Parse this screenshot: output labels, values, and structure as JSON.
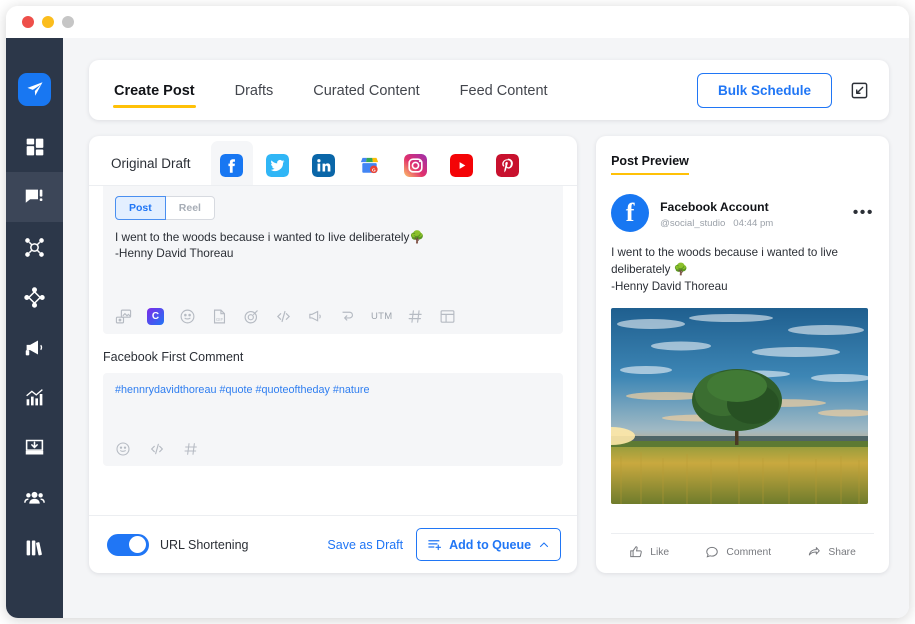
{
  "window": {
    "controls": [
      "close",
      "minimize",
      "maximize"
    ]
  },
  "sidebar": {
    "items": [
      {
        "name": "logo",
        "icon": "paper-plane-icon"
      },
      {
        "name": "dashboard",
        "icon": "grid-icon"
      },
      {
        "name": "publish",
        "icon": "message-icon",
        "active": true
      },
      {
        "name": "network",
        "icon": "network-icon"
      },
      {
        "name": "engage",
        "icon": "diamond-nodes-icon"
      },
      {
        "name": "campaigns",
        "icon": "megaphone-icon"
      },
      {
        "name": "analytics",
        "icon": "chart-icon"
      },
      {
        "name": "inbox",
        "icon": "inbox-download-icon"
      },
      {
        "name": "team",
        "icon": "users-icon"
      },
      {
        "name": "library",
        "icon": "books-icon"
      }
    ]
  },
  "topbar": {
    "tabs": [
      {
        "label": "Create Post",
        "active": true
      },
      {
        "label": "Drafts",
        "active": false
      },
      {
        "label": "Curated Content",
        "active": false
      },
      {
        "label": "Feed Content",
        "active": false
      }
    ],
    "bulk_schedule_label": "Bulk Schedule",
    "compose_icon": "compose-icon"
  },
  "composer": {
    "original_draft_label": "Original Draft",
    "networks": [
      {
        "name": "facebook",
        "active": true
      },
      {
        "name": "twitter",
        "active": false
      },
      {
        "name": "linkedin",
        "active": false
      },
      {
        "name": "google-business",
        "active": false
      },
      {
        "name": "instagram",
        "active": false
      },
      {
        "name": "youtube",
        "active": false
      },
      {
        "name": "pinterest",
        "active": false
      }
    ],
    "post_reel": {
      "post_label": "Post",
      "reel_label": "Reel",
      "selected": "Post"
    },
    "post_text_line1": "I went to the woods because i wanted to live deliberately",
    "post_emoji": "🌳",
    "post_text_line2": "-Henny David Thoreau",
    "toolbar": [
      {
        "name": "media-icon"
      },
      {
        "name": "canva-icon",
        "label": "C"
      },
      {
        "name": "emoji-icon"
      },
      {
        "name": "gif-icon"
      },
      {
        "name": "target-icon"
      },
      {
        "name": "code-icon"
      },
      {
        "name": "megaphone-icon"
      },
      {
        "name": "tap-icon"
      },
      {
        "name": "utm-icon",
        "label": "UTM"
      },
      {
        "name": "hashtag-icon"
      },
      {
        "name": "template-icon"
      }
    ],
    "first_comment_label": "Facebook First Comment",
    "first_comment_text": "#hennrydavidthoreau #quote #quoteoftheday #nature",
    "comment_tools": [
      {
        "name": "emoji-icon"
      },
      {
        "name": "code-icon"
      },
      {
        "name": "hashtag-icon"
      }
    ],
    "url_shortening_label": "URL Shortening",
    "url_shortening_on": true,
    "save_draft_label": "Save as Draft",
    "add_queue_label": "Add to Queue"
  },
  "preview": {
    "title": "Post Preview",
    "account_name": "Facebook Account",
    "handle": "@social_studio",
    "time": "04:44 pm",
    "more_icon": "ellipsis-icon",
    "text_line1": "I went to the woods because i wanted to live",
    "text_line2": "deliberately",
    "emoji": "🌳",
    "text_line3": "-Henny David Thoreau",
    "image_alt": "sunset-tree-field-photo",
    "actions": [
      {
        "label": "Like",
        "icon": "thumbs-up-icon"
      },
      {
        "label": "Comment",
        "icon": "comment-bubble-icon"
      },
      {
        "label": "Share",
        "icon": "share-arrow-icon"
      }
    ]
  },
  "colors": {
    "accent_yellow": "#ffc107",
    "brand_blue": "#2076f5",
    "facebook_blue": "#1877f2",
    "rail_dark": "#2c3749",
    "canvas_gray": "#f4f5f7"
  }
}
